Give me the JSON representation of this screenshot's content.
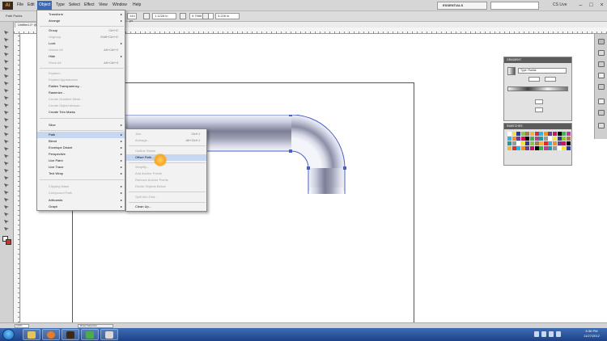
{
  "menubar": {
    "logo": "Ai",
    "items": [
      "File",
      "Edit",
      "Object",
      "Type",
      "Select",
      "Effect",
      "View",
      "Window",
      "Help"
    ],
    "open_item": "Object",
    "workspace": "ESSENTIALS",
    "user": "CS Live"
  },
  "controlbar": {
    "selection_label": "Path Points",
    "field_x": "144 px",
    "field_y": "1.1228 in",
    "field_w": "9.7988 in",
    "field_h": "3.226 in"
  },
  "document_tab": "Untitled-1* @",
  "object_menu": [
    {
      "label": "Transform",
      "submenu": true,
      "disabled": false
    },
    {
      "label": "Arrange",
      "submenu": true,
      "disabled": false
    },
    {
      "sep": true
    },
    {
      "label": "Group",
      "shortcut": "Ctrl+G",
      "disabled": false
    },
    {
      "label": "Ungroup",
      "shortcut": "Shift+Ctrl+G",
      "disabled": true
    },
    {
      "label": "Lock",
      "submenu": true,
      "disabled": false
    },
    {
      "label": "Unlock All",
      "shortcut": "Alt+Ctrl+2",
      "disabled": true
    },
    {
      "label": "Hide",
      "submenu": true,
      "disabled": false
    },
    {
      "label": "Show All",
      "shortcut": "Alt+Ctrl+3",
      "disabled": true
    },
    {
      "sep": true
    },
    {
      "label": "Expand...",
      "disabled": true
    },
    {
      "label": "Expand Appearance",
      "disabled": true
    },
    {
      "label": "Flatten Transparency...",
      "disabled": false
    },
    {
      "label": "Rasterize...",
      "disabled": false
    },
    {
      "label": "Create Gradient Mesh...",
      "disabled": true
    },
    {
      "label": "Create Object Mosaic...",
      "disabled": true
    },
    {
      "label": "Create Trim Marks",
      "disabled": false
    },
    {
      "sep": true
    },
    {
      "label": "Slice",
      "submenu": true,
      "disabled": false
    },
    {
      "sep": true
    },
    {
      "label": "Path",
      "submenu": true,
      "disabled": false,
      "highlight": true
    },
    {
      "label": "Blend",
      "submenu": true,
      "disabled": false
    },
    {
      "label": "Envelope Distort",
      "submenu": true,
      "disabled": false
    },
    {
      "label": "Perspective",
      "submenu": true,
      "disabled": false
    },
    {
      "label": "Live Paint",
      "submenu": true,
      "disabled": false
    },
    {
      "label": "Live Trace",
      "submenu": true,
      "disabled": false
    },
    {
      "label": "Text Wrap",
      "submenu": true,
      "disabled": false
    },
    {
      "sep": true
    },
    {
      "label": "Clipping Mask",
      "submenu": true,
      "disabled": true
    },
    {
      "label": "Compound Path",
      "submenu": true,
      "disabled": true
    },
    {
      "label": "Artboards",
      "submenu": true,
      "disabled": false
    },
    {
      "label": "Graph",
      "submenu": true,
      "disabled": false
    }
  ],
  "path_menu": [
    {
      "label": "Join",
      "shortcut": "Ctrl+J",
      "disabled": true
    },
    {
      "label": "Average...",
      "shortcut": "Alt+Ctrl+J",
      "disabled": true
    },
    {
      "sep": true
    },
    {
      "label": "Outline Stroke",
      "disabled": true
    },
    {
      "label": "Offset Path...",
      "disabled": false,
      "highlight": true
    },
    {
      "sep": true
    },
    {
      "label": "Simplify...",
      "disabled": true
    },
    {
      "label": "Add Anchor Points",
      "disabled": true
    },
    {
      "label": "Remove Anchor Points",
      "disabled": true
    },
    {
      "label": "Divide Objects Below",
      "disabled": true
    },
    {
      "sep": true
    },
    {
      "label": "Split Into Grid...",
      "disabled": true
    },
    {
      "sep": true
    },
    {
      "label": "Clean Up...",
      "disabled": false
    }
  ],
  "gradient_panel": {
    "tab": "GRADIENT",
    "type": "Type: Radial"
  },
  "swatches_panel": {
    "tab": "SWATCHES"
  },
  "statusbar": {
    "zoom": "100%",
    "tool": "Direct Selection"
  },
  "taskbar": {
    "time": "5:36 PM",
    "date": "11/27/2012"
  },
  "colors": {
    "menu_highlight": "#c6d7ef",
    "pipe_light": "#e6e8f2",
    "pipe_dark": "#6f7288",
    "selection_outline": "#4a5fc4"
  }
}
